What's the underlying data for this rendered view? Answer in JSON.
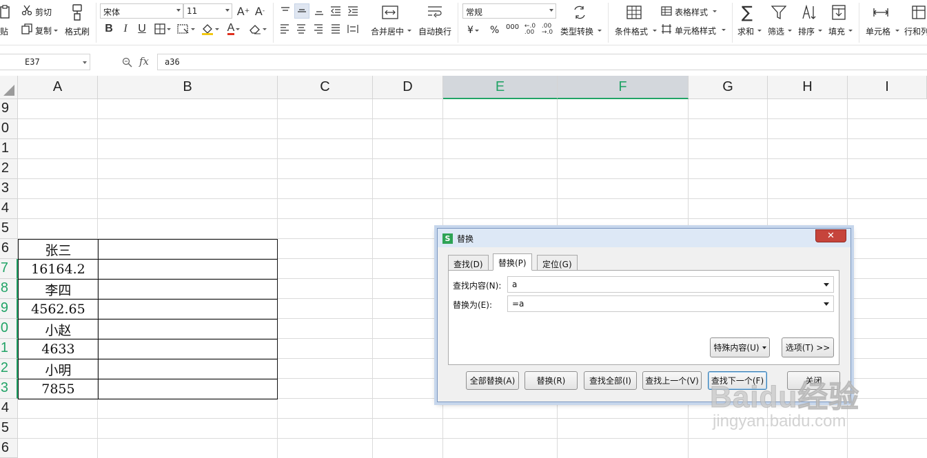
{
  "ribbon": {
    "clipboard": {
      "paste": "贴",
      "cut": "剪切",
      "copy": "复制",
      "format_painter": "格式刷"
    },
    "font": {
      "name": "宋体",
      "size": "11"
    },
    "alignment": {
      "merge_center": "合并居中",
      "wrap_text": "自动换行"
    },
    "number": {
      "format": "常规",
      "currency_symbol": "¥",
      "percent_symbol": "%",
      "thousands": "000",
      "type_convert": "类型转换"
    },
    "styles": {
      "conditional_format": "条件格式",
      "table_style": "表格样式",
      "cell_style": "单元格样式"
    },
    "editing": {
      "sum": "求和",
      "filter": "筛选",
      "sort": "排序",
      "fill": "填充",
      "cell": "单元格",
      "row_col": "行和列"
    }
  },
  "formula_bar": {
    "name_box": "E37",
    "fx": "fx",
    "value": "a36"
  },
  "sheet": {
    "columns": [
      "A",
      "B",
      "C",
      "D",
      "E",
      "F",
      "G",
      "H",
      "I"
    ],
    "selected_columns": [
      "E",
      "F"
    ],
    "row_numbers": [
      "9",
      "0",
      "1",
      "2",
      "3",
      "4",
      "5",
      "6",
      "7",
      "8",
      "9",
      "0",
      "1",
      "2",
      "3",
      "4",
      "5",
      "6"
    ],
    "cells": [
      "张三",
      "16164.2",
      "李四",
      "4562.65",
      "小赵",
      "4633",
      "小明",
      "7855"
    ]
  },
  "dialog": {
    "app_icon": "S",
    "title": "替换",
    "close": "✕",
    "tabs": [
      "查找(D)",
      "替换(P)",
      "定位(G)"
    ],
    "find_label": "查找内容(N):",
    "find_value": "a",
    "replace_label": "替换为(E):",
    "replace_value": "=a",
    "special_button": "特殊内容(U)",
    "options_button": "选项(T) >>",
    "buttons": [
      "全部替换(A)",
      "替换(R)",
      "查找全部(I)",
      "查找上一个(V)",
      "查找下一个(F)",
      "关闭"
    ]
  },
  "watermark": {
    "main": "Baidu经验",
    "sub": "jingyan.baidu.com"
  }
}
